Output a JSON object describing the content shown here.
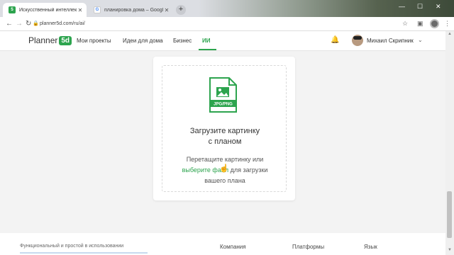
{
  "browser": {
    "tabs": [
      {
        "title": "Искусственный интеллект - Pla",
        "favicon": "planner5d-favicon",
        "color": "#2da44e"
      },
      {
        "title": "планировка дома – Google По",
        "favicon": "google-favicon",
        "color": "#4285f4"
      }
    ],
    "url": "planner5d.com/ru/ai/"
  },
  "header": {
    "logo_text": "Planner",
    "logo_badge": "5d",
    "nav": [
      "Мои проекты",
      "Идеи для дома",
      "Бизнес",
      "ИИ"
    ],
    "active_nav": "ИИ",
    "user_name": "Михаил Скрипник",
    "accent": "#2da44e"
  },
  "upload": {
    "file_label": "JPG/PNG",
    "title_line1": "Загрузите картинку",
    "title_line2": "с планом",
    "hint_line1": "Перетащите картинку или",
    "hint_link": "выберите файл",
    "hint_after_link": " для загрузки",
    "hint_line3": "вашего плана"
  },
  "footer": {
    "text": "Функциональный и простой в использовании",
    "columns": [
      "Компания",
      "Платформы",
      "Язык"
    ]
  }
}
